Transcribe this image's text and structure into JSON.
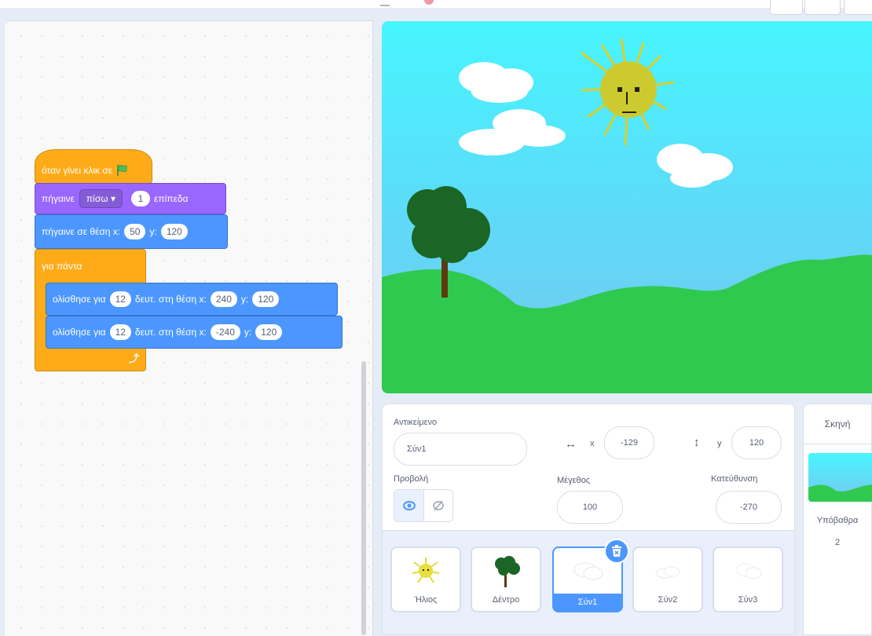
{
  "code": {
    "hat_label": "όταν γίνει κλικ σε",
    "goto_layer": {
      "label": "πήγαινε",
      "dropdown": "πίσω",
      "value": "1",
      "suffix": "επίπεδα"
    },
    "goto_xy": {
      "label": "πήγαινε σε θέση x:",
      "x": "50",
      "y_label": "y:",
      "y": "120"
    },
    "forever_label": "για πάντα",
    "glide1": {
      "label": "ολίσθησε για",
      "secs": "12",
      "mid": "δευτ. στη θέση x:",
      "x": "240",
      "y_label": "y:",
      "y": "120"
    },
    "glide2": {
      "label": "ολίσθησε για",
      "secs": "12",
      "mid": "δευτ. στη θέση x:",
      "x": "-240",
      "y_label": "y:",
      "y": "120"
    },
    "loop_icon": "loop-arrow-icon"
  },
  "sprite_info": {
    "sprite_label": "Αντικείμενο",
    "sprite_name": "Σύν1",
    "x_label": "x",
    "x_value": "-129",
    "y_label": "y",
    "y_value": "120",
    "show_label": "Προβολή",
    "size_label": "Μέγεθος",
    "size_value": "100",
    "direction_label": "Κατεύθυνση",
    "direction_value": "-270"
  },
  "sprites": [
    {
      "name": "Ήλιος",
      "icon": "sun-icon"
    },
    {
      "name": "Δέντρο",
      "icon": "tree-icon"
    },
    {
      "name": "Σύν1",
      "icon": "cloud-icon",
      "selected": true
    },
    {
      "name": "Σύν2",
      "icon": "cloud-icon"
    },
    {
      "name": "Σύν3",
      "icon": "cloud-icon"
    }
  ],
  "stage_panel": {
    "title": "Σκηνή",
    "backdrops_label": "Υπόβαθρα",
    "backdrops_count": "2"
  },
  "colors": {
    "events": "#ffab19",
    "looks": "#9966ff",
    "motion": "#4c97ff",
    "selected": "#4c97ff"
  }
}
